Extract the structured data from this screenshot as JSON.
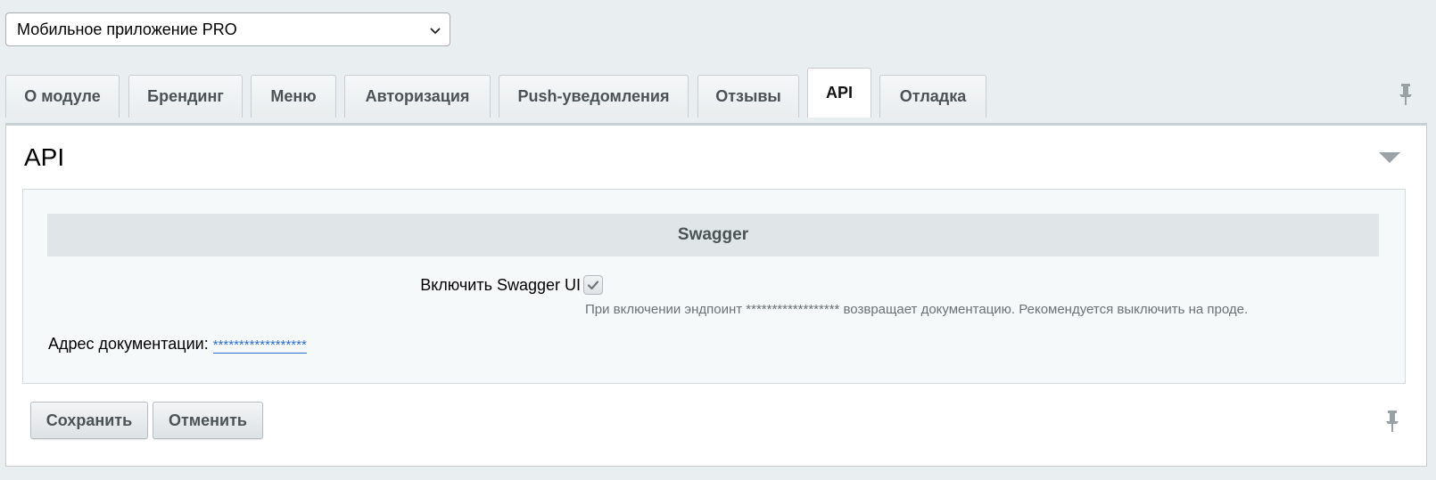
{
  "module_select": {
    "value": "Мобильное приложение PRO"
  },
  "tabs": [
    {
      "label": "О модуле",
      "active": false
    },
    {
      "label": "Брендинг",
      "active": false
    },
    {
      "label": "Меню",
      "active": false
    },
    {
      "label": "Авторизация",
      "active": false
    },
    {
      "label": "Push-уведомления",
      "active": false
    },
    {
      "label": "Отзывы",
      "active": false
    },
    {
      "label": "API",
      "active": true
    },
    {
      "label": "Отладка",
      "active": false
    }
  ],
  "panel": {
    "title": "API",
    "section_title": "Swagger",
    "swagger_label": "Включить Swagger UI",
    "swagger_enabled": true,
    "hint": "При включении эндпоинт ****************** возвращает документацию. Рекомендуется выключить на проде.",
    "doc_label": "Адрес документации:",
    "doc_link": "******************"
  },
  "buttons": {
    "save": "Сохранить",
    "cancel": "Отменить"
  },
  "icons": {
    "select_chevron": "chevron-down-icon",
    "collapse": "triangle-down-icon",
    "pin": "pin-icon",
    "check": "checkmark-icon"
  },
  "colors": {
    "background": "#e9eef1",
    "link": "#2f6fd0",
    "section_header": "#e0e6e8"
  }
}
